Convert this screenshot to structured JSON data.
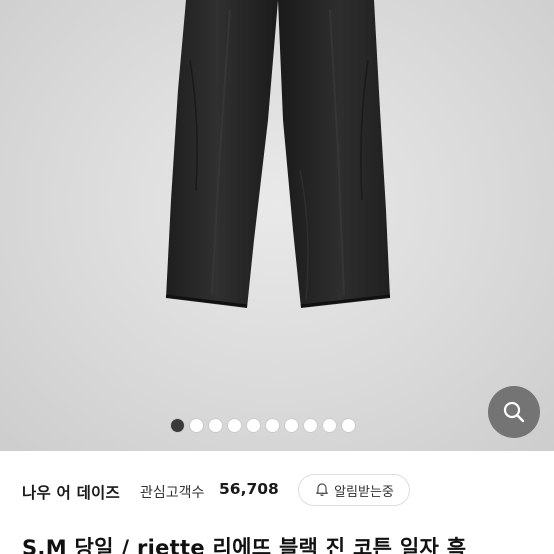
{
  "gallery": {
    "image_count": 10,
    "current_index": 1,
    "zoom_icon": "magnifier-icon"
  },
  "seller": {
    "shop_name": "나우 어 데이즈",
    "follower_label": "관심고객수",
    "follower_count": "56,708",
    "notify_label": "알림받는중",
    "notify_icon": "bell-icon"
  },
  "product": {
    "title": "S.M 당일 / riette 리에뜨 블랙 진 코튼 일자 흑"
  },
  "colors": {
    "active_dot": "#3a3a3a",
    "inactive_dot": "#ffffff",
    "jeans": "#262626"
  }
}
